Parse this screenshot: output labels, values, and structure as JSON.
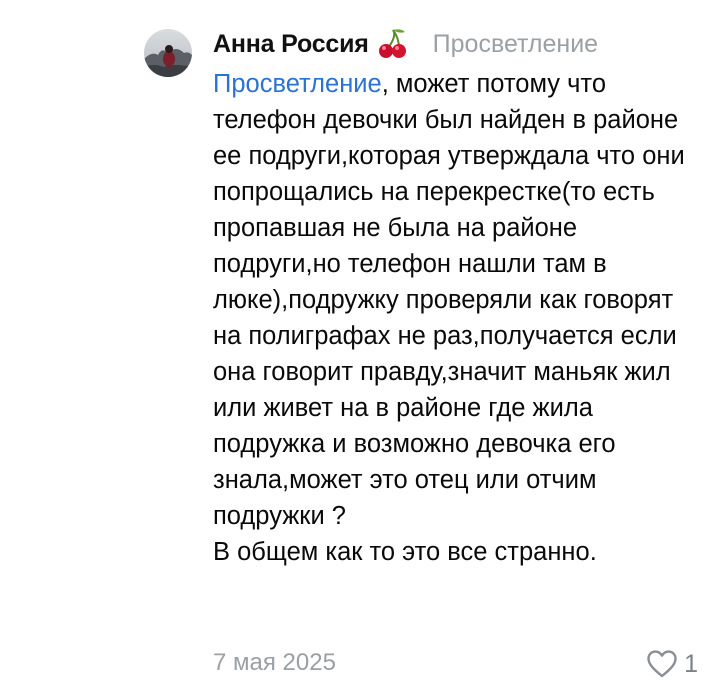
{
  "comment": {
    "author_name": "Анна Россия",
    "author_emoji_icon": "cherries-icon",
    "reply_to": "Просветление",
    "mention": "Просветление",
    "text": ", может потому что телефон девочки был найден в районе ее подруги,которая утверждала что они попрощались на перекрестке(то есть пропавшая не была на районе подруги,но телефон нашли там в люке),подружку проверяли как говорят на полиграфах не раз,получается если она говорит правду,значит маньяк жил или живет на в районе где жила подружка и возможно девочка его знала,может это отец или отчим подружки ?\nВ общем как то это все странно.",
    "date": "7 мая 2025",
    "likes": "1",
    "like_icon": "heart-outline-icon"
  },
  "colors": {
    "mention": "#2a72d4",
    "muted": "#9aa0a6",
    "text": "#0a0a0a"
  }
}
